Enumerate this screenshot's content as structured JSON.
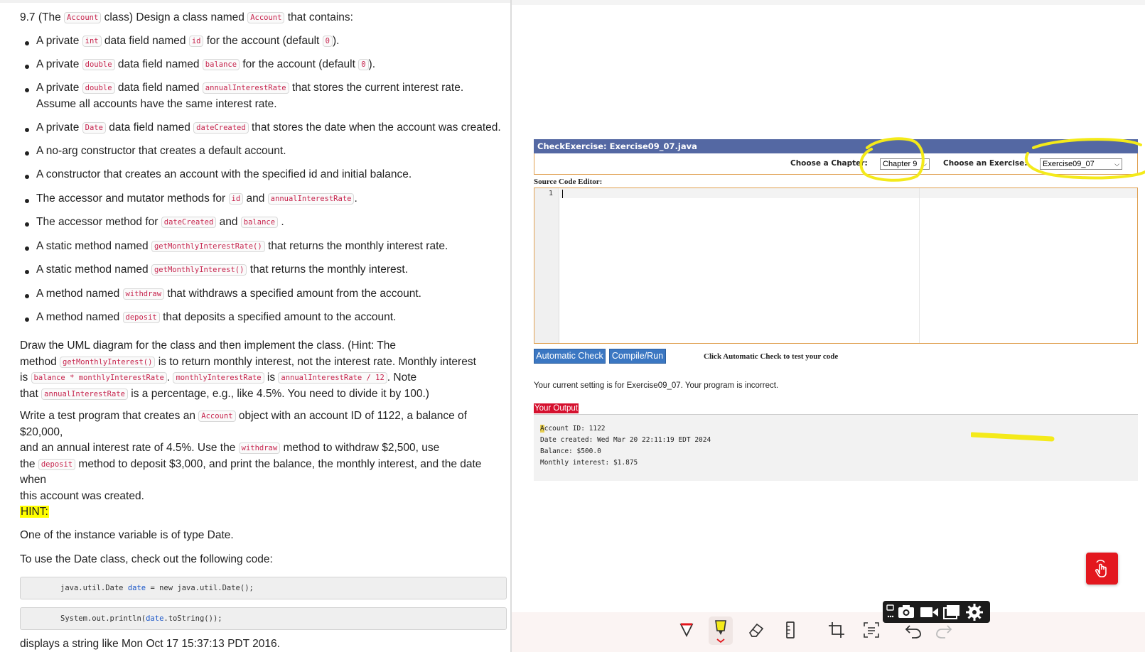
{
  "left": {
    "heading": {
      "pre": "9.7 (The ",
      "code1": "Account",
      "mid": " class) Design a class named ",
      "code2": "Account",
      "post": " that contains:"
    },
    "bullets": [
      {
        "a": "A private ",
        "c1": "int",
        "b": " data field named ",
        "c2": "id",
        "d": " for the account (default ",
        "c3": "0",
        "e": ")."
      },
      {
        "a": "A private ",
        "c1": "double",
        "b": " data field named ",
        "c2": "balance",
        "d": " for the account (default ",
        "c3": "0",
        "e": ")."
      },
      {
        "a": "A private ",
        "c1": "double",
        "b": " data field named ",
        "c2": "annualInterestRate",
        "d": " that stores the current interest rate. Assume all accounts have the same interest rate."
      },
      {
        "a": "A private ",
        "c1": "Date",
        "b": " data field named ",
        "c2": "dateCreated",
        "d": " that stores the date when the account was created."
      },
      {
        "a": "A no-arg constructor that creates a default account."
      },
      {
        "a": "A constructor that creates an account with the specified id and initial balance."
      },
      {
        "a": "The accessor and mutator methods for ",
        "c1": "id",
        "b": " and ",
        "c2": "annualInterestRate",
        "d": "."
      },
      {
        "a": "The accessor method for ",
        "c1": "dateCreated",
        "b": " and ",
        "c2": "balance",
        "d": " ."
      },
      {
        "a": "A static method named ",
        "c1": "getMonthlyInterestRate()",
        "b": " that returns the monthly interest rate."
      },
      {
        "a": "A static method named ",
        "c1": "getMonthlyInterest()",
        "b": " that returns the monthly interest."
      },
      {
        "a": "A method named ",
        "c1": "withdraw",
        "b": " that withdraws a specified amount from the account."
      },
      {
        "a": "A method named ",
        "c1": "deposit",
        "b": " that deposits a specified amount to the account."
      }
    ],
    "para1": {
      "l1": "Draw the UML diagram for the class and then implement the class. (Hint: The",
      "l2a": "method ",
      "l2c": "getMonthlyInterest()",
      "l2b": " is to return monthly interest, not the interest rate. Monthly interest",
      "l3a": "is ",
      "l3c1": "balance * monthlyInterestRate",
      "l3b": ". ",
      "l3c2": "monthlyInterestRate",
      "l3d": " is ",
      "l3c3": "annualInterestRate / 12",
      "l3e": ". Note",
      "l4a": "that ",
      "l4c": "annualInterestRate",
      "l4b": " is a percentage, e.g., like 4.5%. You need to divide it by 100.)"
    },
    "para2": {
      "l1a": "Write a test program that creates an ",
      "l1c": "Account",
      "l1b": " object with an account ID of 1122, a balance of $20,000,",
      "l2a": "and an annual interest rate of 4.5%. Use the ",
      "l2c": "withdraw",
      "l2b": " method to withdraw $2,500, use",
      "l3a": "the ",
      "l3c": "deposit",
      "l3b": " method to deposit $3,000, and print the balance, the monthly interest, and the date when",
      "l4": "this account was created."
    },
    "hint_label": "HINT:",
    "hint_line1": "One of the instance variable is of type Date.",
    "hint_line2": "To use the Date class, check out the following code:",
    "code_line1": {
      "a": "java.util.Date ",
      "kw": "date",
      "b": " = new java.util.Date();"
    },
    "code_line2": {
      "a": "System.out.println(",
      "kw": "date",
      "b": ".toString());"
    },
    "footer_line": "displays a string like Mon Oct 17 15:37:13 PDT 2016."
  },
  "right": {
    "title": "CheckExercise: Exercise09_07.java",
    "chapter_label": "Choose a Chapter:",
    "chapter_value": "Chapter 9",
    "exercise_label": "Choose an Exercise:",
    "exercise_value": "Exercise09_07",
    "source_label": "Source Code Editor:",
    "line_number": "1",
    "auto_check_label": "Automatic Check",
    "compile_run_label": "Compile/Run",
    "click_hint": "Click Automatic Check to test your code",
    "status": "Your current setting is for Exercise09_07. Your program is incorrect.",
    "output_label": "Your Output",
    "output_first_char": "A",
    "output_lines": [
      "ccount ID: 1122",
      "Date created: Wed Mar 20 22:11:19 EDT 2024",
      "Balance: $500.0",
      "Monthly interest: $1.875"
    ],
    "accent_color": "#5468a3",
    "button_color": "#3b77c2",
    "output_label_color": "#d5102e",
    "highlight_color": "#f4ea1a",
    "icons": {
      "float": "touch-hand-icon",
      "dark_toolbar": [
        "camera-settings-icon",
        "camera-icon",
        "video-icon",
        "window-icon",
        "gear-icon"
      ],
      "bottom_toolbar": [
        "pen-icon",
        "highlighter-icon",
        "eraser-icon",
        "ruler-icon",
        "crop-icon",
        "text-select-icon",
        "undo-icon",
        "redo-icon"
      ]
    }
  }
}
